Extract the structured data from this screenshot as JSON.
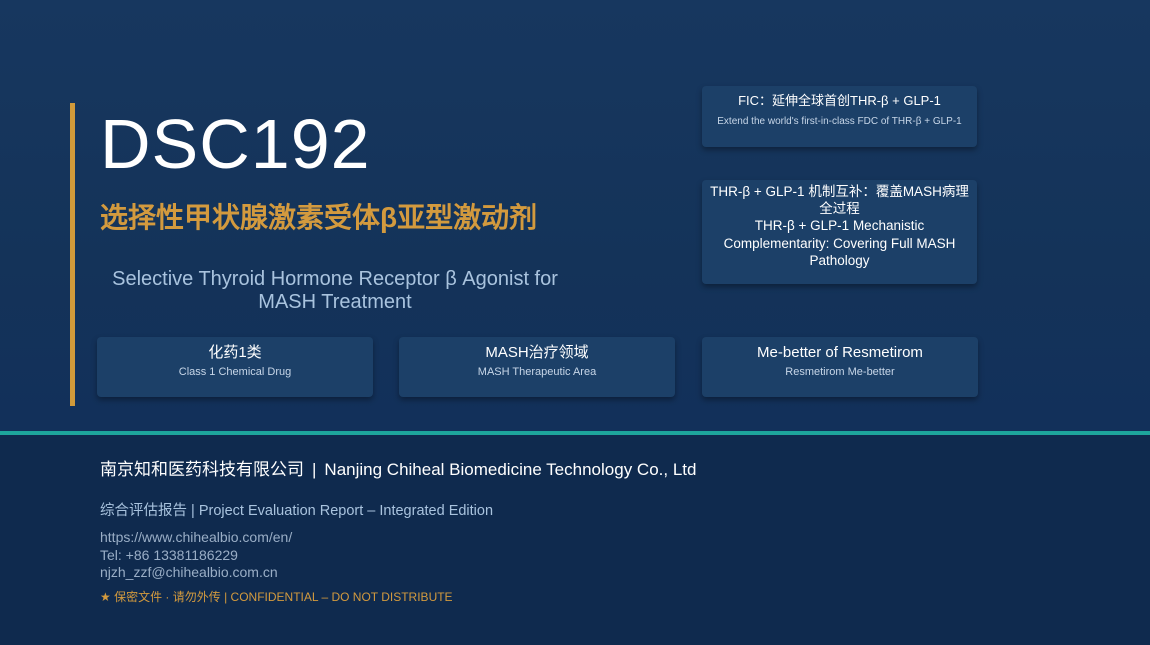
{
  "title": "DSC192",
  "subtitle_cn": "选择性甲状腺激素受体β亚型激动剂",
  "subtitle_en": "Selective Thyroid Hormone Receptor β Agonist for MASH Treatment",
  "right_cards": [
    {
      "cn": "FIC：延伸全球首创THR-β + GLP-1",
      "en": "Extend the world's first-in-class FDC of THR-β + GLP-1"
    },
    {
      "cn": "THR-β + GLP-1 机制互补：覆盖MASH病理全过程",
      "en": "THR-β + GLP-1 Mechanistic Complementarity: Covering Full MASH Pathology"
    }
  ],
  "features": [
    {
      "cn": "化药1类",
      "en": "Class 1 Chemical Drug"
    },
    {
      "cn": "MASH治疗领域",
      "en": "MASH Therapeutic Area"
    },
    {
      "cn": "Me-better of Resmetirom",
      "en": "Resmetirom Me-better"
    }
  ],
  "company": {
    "cn": "南京知和医药科技有限公司",
    "separator": "|",
    "en": "Nanjing Chiheal Biomedicine Technology Co., Ltd"
  },
  "report": "综合评估报告 |  Project Evaluation Report  –  Integrated Edition",
  "contact": {
    "website": "https://www.chihealbio.com/en/",
    "tel": "Tel: +86 13381186229",
    "email": "njzh_zzf@chihealbio.com.cn"
  },
  "confidential": "★ 保密文件 · 请勿外传 | CONFIDENTIAL – DO NOT DISTRIBUTE",
  "colors": {
    "background": "#143359",
    "accent_gold": "#d19a3a",
    "divider_teal": "#1ea59c",
    "card": "#1c4068",
    "footer": "#0f2a4e"
  }
}
